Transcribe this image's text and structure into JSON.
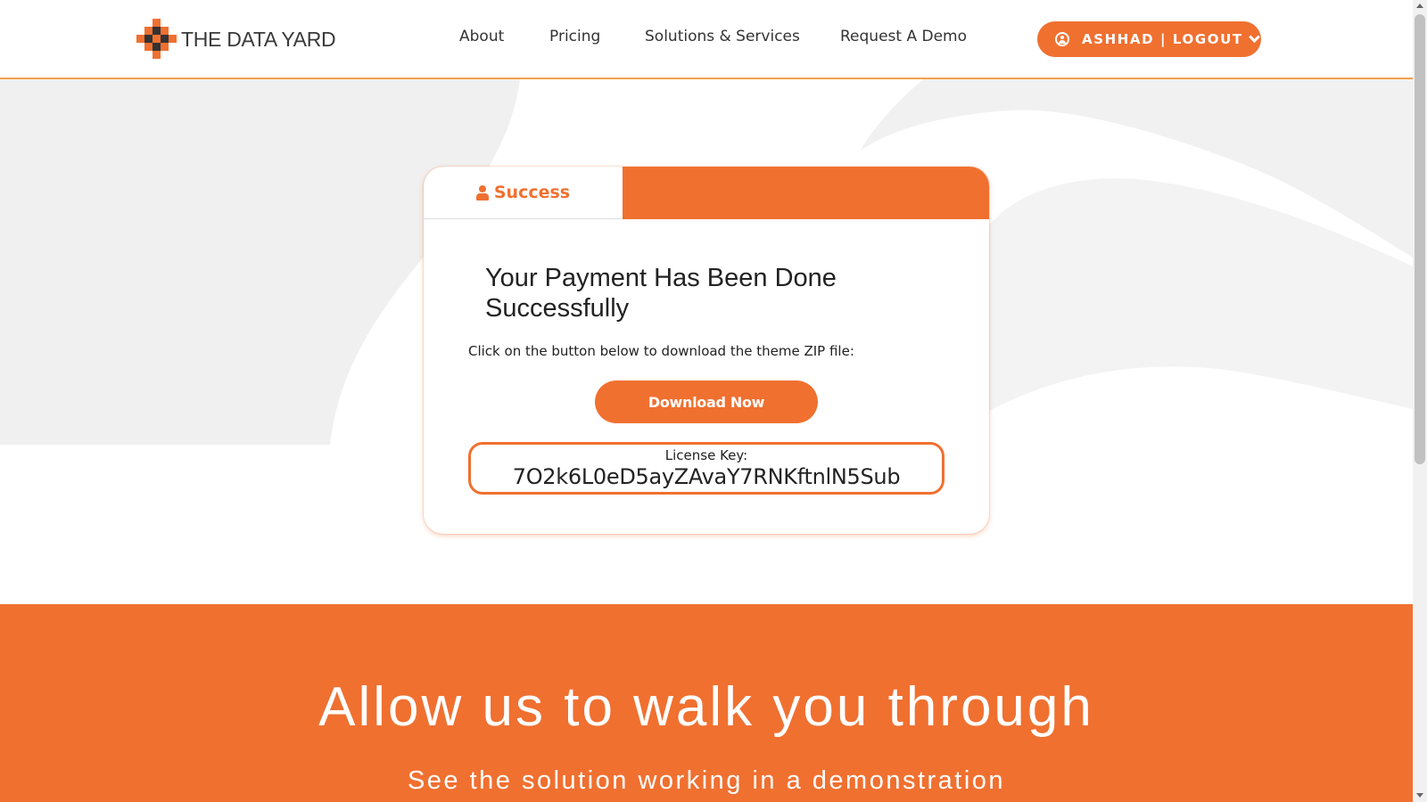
{
  "brand": {
    "name": "THE DATA YARD",
    "accent_color": "#f07030",
    "logo_dark_color": "#333333"
  },
  "nav": {
    "items": [
      {
        "label": "About"
      },
      {
        "label": "Pricing"
      },
      {
        "label": "Solutions & Services"
      },
      {
        "label": "Request A Demo"
      }
    ]
  },
  "user_menu": {
    "label": "ASHHAD | LOGOUT",
    "icon": "user-circle-icon",
    "caret_icon": "chevron-down-icon"
  },
  "card": {
    "tab_label": "Success",
    "tab_icon": "person-icon",
    "title": "Your Payment Has Been Done Successfully",
    "instruction": "Click on the button below to download the theme ZIP file:",
    "download_label": "Download Now",
    "license_label": "License Key:",
    "license_key": "7O2k6L0eD5ayZAvaY7RNKftnlN5Sub"
  },
  "cta": {
    "title": "Allow us to walk you through",
    "subtitle": "See the solution working in a demonstration"
  }
}
